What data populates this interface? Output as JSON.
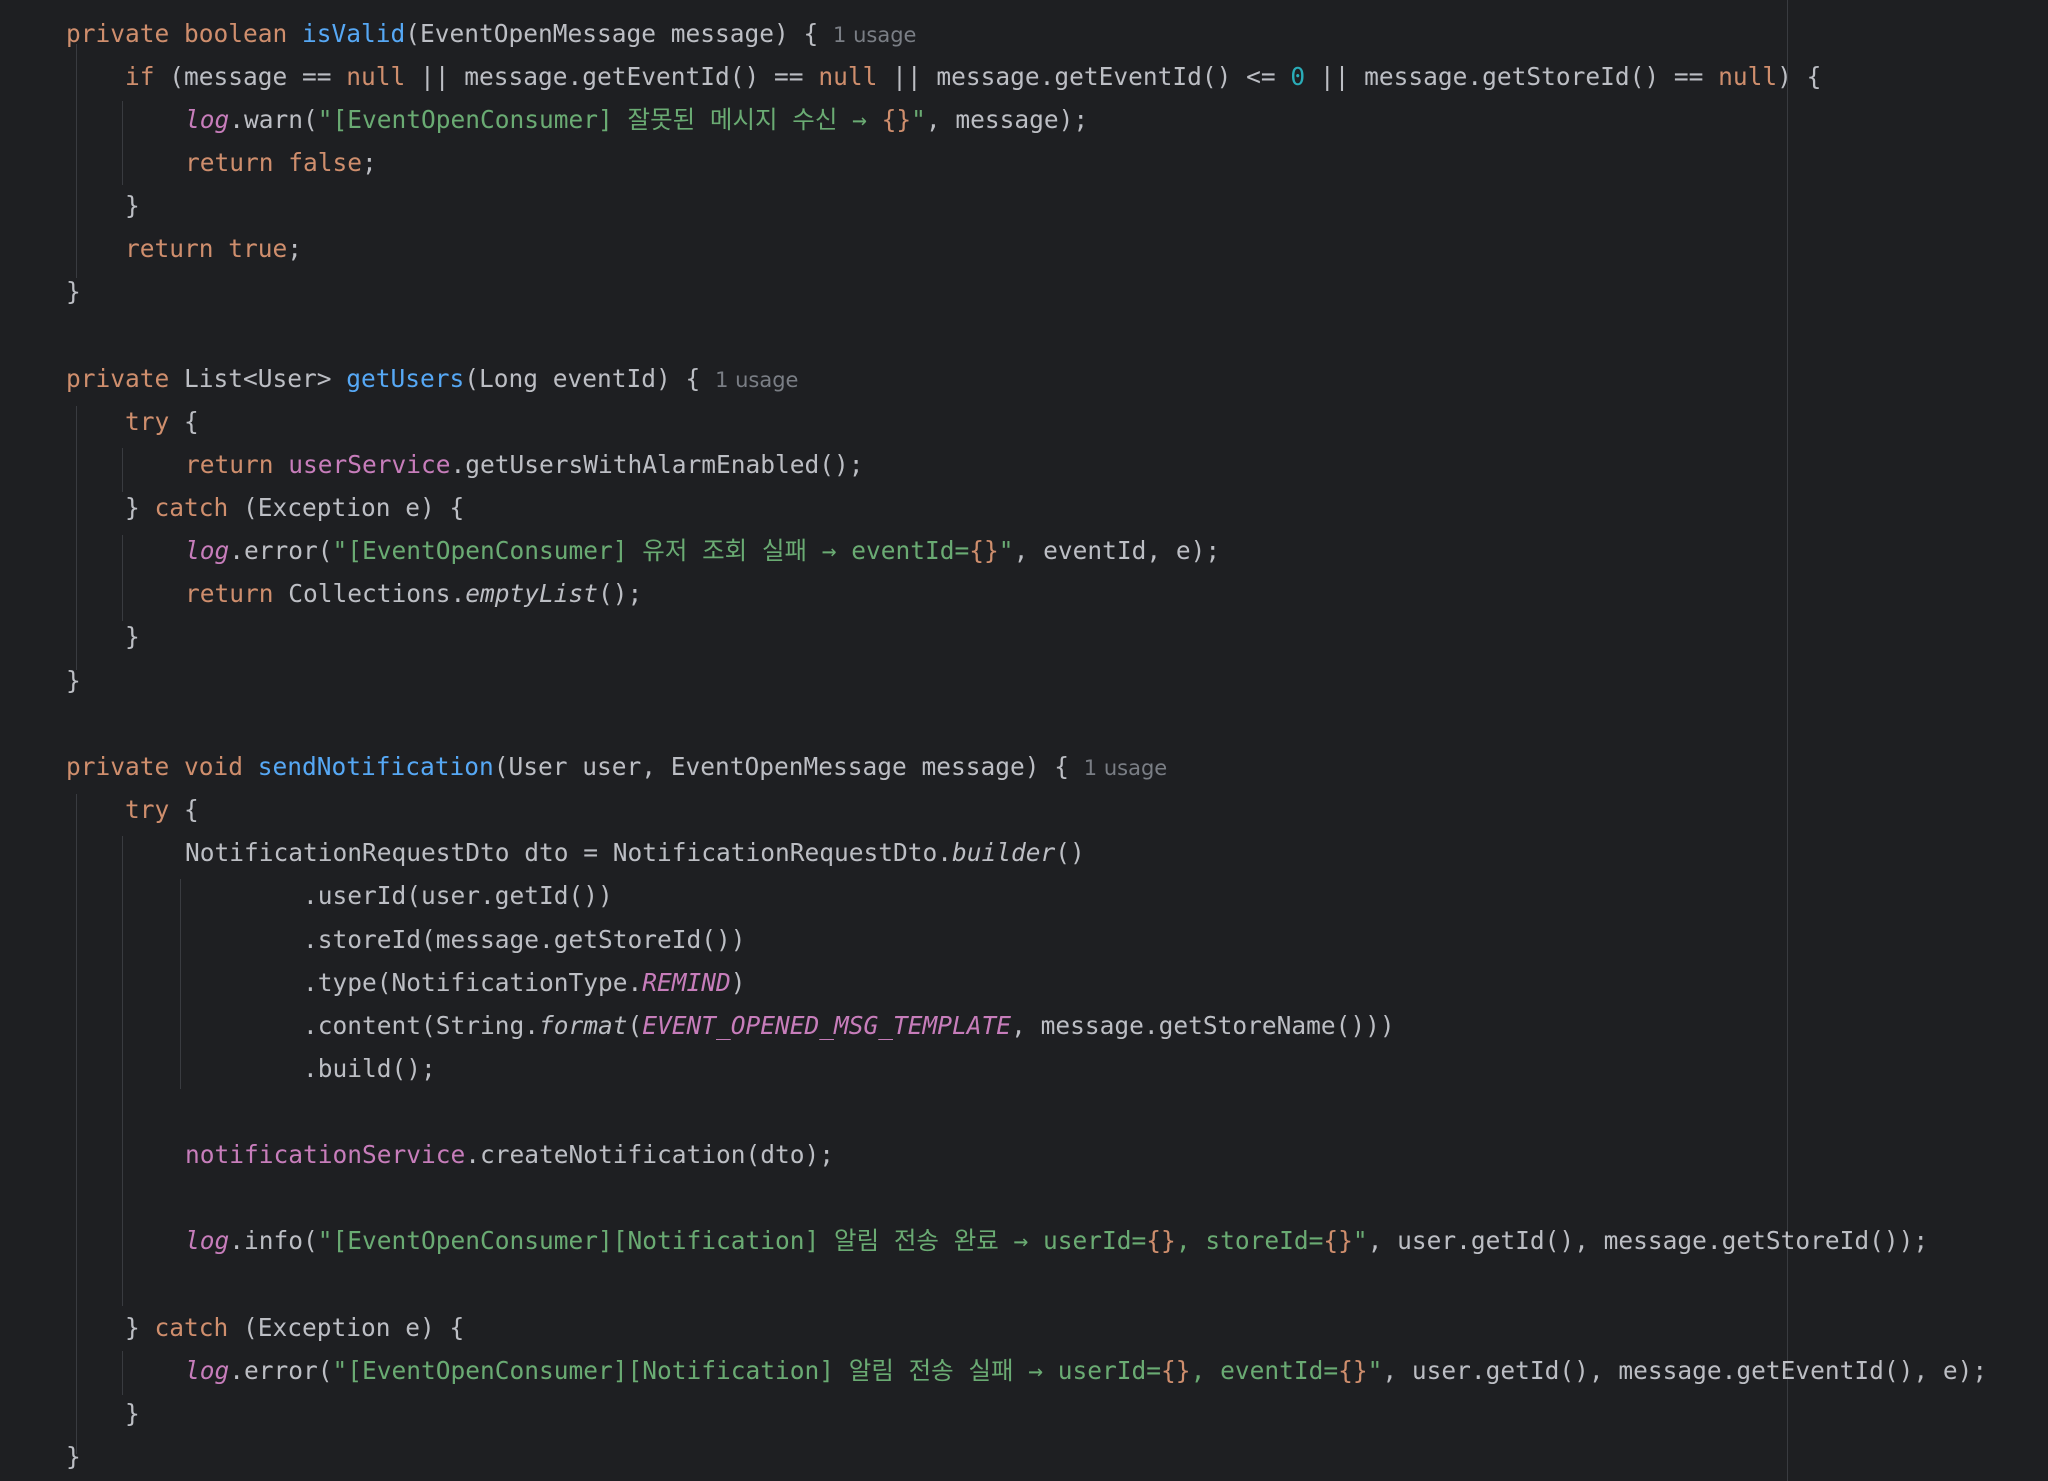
{
  "editor": {
    "usage_hint": "1 usage",
    "lines": [
      {
        "id": "l1",
        "tokens": [
          [
            "kw",
            "private boolean "
          ],
          [
            "fn",
            "isValid"
          ],
          [
            "",
            "(EventOpenMessage message) { "
          ],
          [
            "hint",
            "1 usage"
          ]
        ]
      },
      {
        "id": "l2",
        "tokens": [
          [
            "kw",
            "if "
          ],
          [
            "",
            "(message == "
          ],
          [
            "kw",
            "null"
          ],
          [
            "",
            " || message.getEventId() == "
          ],
          [
            "kw",
            "null"
          ],
          [
            "",
            " || message.getEventId() <= "
          ],
          [
            "num",
            "0"
          ],
          [
            "",
            " || message.getStoreId() == "
          ],
          [
            "kw",
            "null"
          ],
          [
            "",
            ") {"
          ]
        ]
      },
      {
        "id": "l3",
        "tokens": [
          [
            "logv",
            "log"
          ],
          [
            "",
            ".warn("
          ],
          [
            "str",
            "\"[EventOpenConsumer] 잘못된 메시지 수신 → "
          ],
          [
            "esc",
            "{}"
          ],
          [
            "str",
            "\""
          ],
          [
            "",
            ", message);"
          ]
        ]
      },
      {
        "id": "l4",
        "tokens": [
          [
            "kw",
            "return false"
          ],
          [
            "",
            ";"
          ]
        ]
      },
      {
        "id": "l5",
        "tokens": [
          [
            "",
            "}"
          ]
        ]
      },
      {
        "id": "l6",
        "tokens": [
          [
            "kw",
            "return true"
          ],
          [
            "",
            ";"
          ]
        ]
      },
      {
        "id": "l7",
        "tokens": [
          [
            "",
            "}"
          ]
        ]
      },
      {
        "id": "l8",
        "tokens": [
          [
            "kw",
            "private "
          ],
          [
            "",
            "List<User> "
          ],
          [
            "fn",
            "getUsers"
          ],
          [
            "",
            "(Long eventId) { "
          ],
          [
            "hint",
            "1 usage"
          ]
        ]
      },
      {
        "id": "l9",
        "tokens": [
          [
            "kw",
            "try "
          ],
          [
            "",
            "{"
          ]
        ]
      },
      {
        "id": "l10",
        "tokens": [
          [
            "kw",
            "return "
          ],
          [
            "fld",
            "userService"
          ],
          [
            "",
            ".getUsersWithAlarmEnabled();"
          ]
        ]
      },
      {
        "id": "l11",
        "tokens": [
          [
            "",
            "} "
          ],
          [
            "kw",
            "catch "
          ],
          [
            "",
            "(Exception e) {"
          ]
        ]
      },
      {
        "id": "l12",
        "tokens": [
          [
            "logv",
            "log"
          ],
          [
            "",
            ".error("
          ],
          [
            "str",
            "\"[EventOpenConsumer] 유저 조회 실패 → eventId="
          ],
          [
            "esc",
            "{}"
          ],
          [
            "str",
            "\""
          ],
          [
            "",
            ", eventId, e);"
          ]
        ]
      },
      {
        "id": "l13",
        "tokens": [
          [
            "kw",
            "return "
          ],
          [
            "",
            "Collections."
          ],
          [
            "it",
            "emptyList"
          ],
          [
            "",
            "();"
          ]
        ]
      },
      {
        "id": "l14",
        "tokens": [
          [
            "",
            "}"
          ]
        ]
      },
      {
        "id": "l15",
        "tokens": [
          [
            "",
            "}"
          ]
        ]
      },
      {
        "id": "l16",
        "tokens": [
          [
            "kw",
            "private void "
          ],
          [
            "fn",
            "sendNotification"
          ],
          [
            "",
            "(User user, EventOpenMessage message) { "
          ],
          [
            "hint",
            "1 usage"
          ]
        ]
      },
      {
        "id": "l17",
        "tokens": [
          [
            "kw",
            "try "
          ],
          [
            "",
            "{"
          ]
        ]
      },
      {
        "id": "l18",
        "tokens": [
          [
            "",
            "NotificationRequestDto dto = NotificationRequestDto."
          ],
          [
            "it",
            "builder"
          ],
          [
            "",
            "()"
          ]
        ]
      },
      {
        "id": "l19",
        "tokens": [
          [
            "",
            ".userId(user.getId())"
          ]
        ]
      },
      {
        "id": "l20",
        "tokens": [
          [
            "",
            ".storeId(message.getStoreId())"
          ]
        ]
      },
      {
        "id": "l21",
        "tokens": [
          [
            "",
            ".type(NotificationType."
          ],
          [
            "const",
            "REMIND"
          ],
          [
            "",
            ")"
          ]
        ]
      },
      {
        "id": "l22",
        "tokens": [
          [
            "",
            ".content(String."
          ],
          [
            "it",
            "format"
          ],
          [
            "",
            "("
          ],
          [
            "const",
            "EVENT_OPENED_MSG_TEMPLATE"
          ],
          [
            "",
            ", message.getStoreName()))"
          ]
        ]
      },
      {
        "id": "l23",
        "tokens": [
          [
            "",
            ".build();"
          ]
        ]
      },
      {
        "id": "l24",
        "tokens": [
          [
            "fld",
            "notificationService"
          ],
          [
            "",
            ".createNotification(dto);"
          ]
        ]
      },
      {
        "id": "l25",
        "tokens": [
          [
            "logv",
            "log"
          ],
          [
            "",
            ".info("
          ],
          [
            "str",
            "\"[EventOpenConsumer][Notification] 알림 전송 완료 → userId="
          ],
          [
            "esc",
            "{}"
          ],
          [
            "str",
            ", storeId="
          ],
          [
            "esc",
            "{}"
          ],
          [
            "str",
            "\""
          ],
          [
            "",
            ", user.getId(), message.getStoreId());"
          ]
        ]
      },
      {
        "id": "l26",
        "tokens": [
          [
            "",
            "} "
          ],
          [
            "kw",
            "catch "
          ],
          [
            "",
            "(Exception e) {"
          ]
        ]
      },
      {
        "id": "l27",
        "tokens": [
          [
            "logv",
            "log"
          ],
          [
            "",
            ".error("
          ],
          [
            "str",
            "\"[EventOpenConsumer][Notification] 알림 전송 실패 → userId="
          ],
          [
            "esc",
            "{}"
          ],
          [
            "str",
            ", eventId="
          ],
          [
            "esc",
            "{}"
          ],
          [
            "str",
            "\""
          ],
          [
            "",
            ", user.getId(), message.getEventId(), e);"
          ]
        ]
      },
      {
        "id": "l28",
        "tokens": [
          [
            "",
            "}"
          ]
        ]
      },
      {
        "id": "l29",
        "tokens": [
          [
            "",
            "}"
          ]
        ]
      }
    ]
  }
}
